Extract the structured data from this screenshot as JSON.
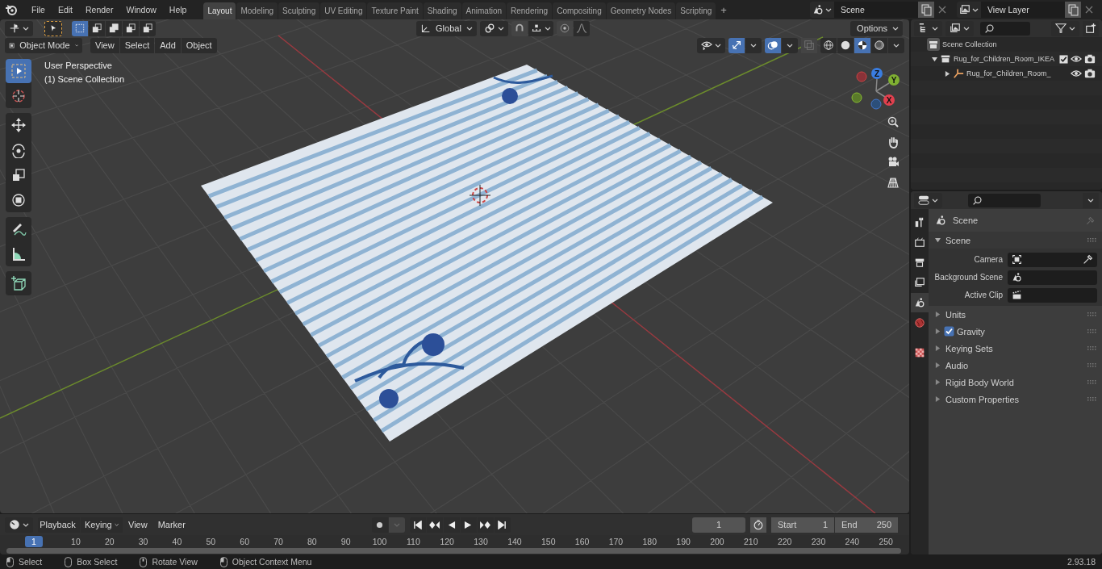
{
  "topbar": {
    "menus": [
      "File",
      "Edit",
      "Render",
      "Window",
      "Help"
    ],
    "workspaces": [
      {
        "label": "Layout",
        "selected": true
      },
      {
        "label": "Modeling",
        "selected": false
      },
      {
        "label": "Sculpting",
        "selected": false
      },
      {
        "label": "UV Editing",
        "selected": false
      },
      {
        "label": "Texture Paint",
        "selected": false
      },
      {
        "label": "Shading",
        "selected": false
      },
      {
        "label": "Animation",
        "selected": false
      },
      {
        "label": "Rendering",
        "selected": false
      },
      {
        "label": "Compositing",
        "selected": false
      },
      {
        "label": "Geometry Nodes",
        "selected": false
      },
      {
        "label": "Scripting",
        "selected": false
      }
    ],
    "add_tab": "+",
    "scene": "Scene",
    "view_layer": "View Layer"
  },
  "viewport": {
    "orientation": "Global",
    "options": "Options",
    "mode": "Object Mode",
    "menus": [
      "View",
      "Select",
      "Add",
      "Object"
    ],
    "select_modes": [
      {
        "selected": true
      },
      {
        "selected": false
      },
      {
        "selected": false
      },
      {
        "selected": false
      },
      {
        "selected": false
      }
    ],
    "overlay_text": [
      "User Perspective",
      "(1) Scene Collection"
    ],
    "tools": [
      {
        "kind": "select",
        "selected": true
      },
      {
        "kind": "cursor",
        "selected": false
      },
      {
        "kind": "move",
        "selected": false
      },
      {
        "kind": "rotate",
        "selected": false
      },
      {
        "kind": "scale",
        "selected": false
      },
      {
        "kind": "transform",
        "selected": false
      },
      {
        "kind": "annotate",
        "selected": false
      },
      {
        "kind": "measure",
        "selected": false
      },
      {
        "kind": "add-cube",
        "selected": false
      }
    ],
    "gizmo_toggle": {
      "on": true
    },
    "overlays": {
      "on": true
    },
    "shading": [
      {
        "kind": "wireframe",
        "selected": false
      },
      {
        "kind": "solid",
        "selected": false
      },
      {
        "kind": "material",
        "selected": true
      },
      {
        "kind": "rendered",
        "selected": false
      }
    ],
    "axes": [
      "X",
      "Y",
      "Z"
    ]
  },
  "outliner": {
    "root": "Scene Collection",
    "items": [
      {
        "label": "Rug_for_Children_Room_IKEA",
        "kind": "collection",
        "expanded": true,
        "checked": true,
        "children": [
          {
            "label": "Rug_for_Children_Room_",
            "kind": "object",
            "expanded": false
          }
        ]
      }
    ]
  },
  "properties": {
    "tabs": [
      {
        "kind": "tool",
        "selected": false
      },
      {
        "kind": "render",
        "selected": false
      },
      {
        "kind": "output",
        "selected": false
      },
      {
        "kind": "view-layer",
        "selected": false
      },
      {
        "kind": "scene",
        "selected": true
      },
      {
        "kind": "world",
        "selected": false
      },
      {
        "kind": "texture",
        "selected": false
      }
    ],
    "context": "Scene",
    "panel": {
      "title": "Scene",
      "expanded": true,
      "fields": [
        {
          "label": "Camera",
          "kind": "camera"
        },
        {
          "label": "Background Scene",
          "kind": "scene"
        },
        {
          "label": "Active Clip",
          "kind": "clip"
        }
      ]
    },
    "subpanels": [
      {
        "label": "Units",
        "kind": "plain",
        "expanded": false
      },
      {
        "label": "Gravity",
        "kind": "checkbox",
        "checked": true,
        "expanded": false
      },
      {
        "label": "Keying Sets",
        "kind": "plain",
        "expanded": false
      },
      {
        "label": "Audio",
        "kind": "plain",
        "expanded": false
      },
      {
        "label": "Rigid Body World",
        "kind": "plain",
        "expanded": false
      },
      {
        "label": "Custom Properties",
        "kind": "plain",
        "expanded": false
      }
    ]
  },
  "timeline": {
    "menus": [
      "Playback",
      "Keying",
      "View",
      "Marker"
    ],
    "current_frame": "1",
    "start": {
      "label": "Start",
      "value": "1"
    },
    "end": {
      "label": "End",
      "value": "250"
    },
    "playhead": "1",
    "ticks": [
      "10",
      "20",
      "30",
      "40",
      "50",
      "60",
      "70",
      "80",
      "90",
      "100",
      "110",
      "120",
      "130",
      "140",
      "150",
      "160",
      "170",
      "180",
      "190",
      "200",
      "210",
      "220",
      "230",
      "240",
      "250"
    ]
  },
  "status_bar": {
    "hints": [
      "Select",
      "Box Select",
      "Rotate View",
      "Object Context Menu"
    ],
    "version": "2.93.18"
  }
}
